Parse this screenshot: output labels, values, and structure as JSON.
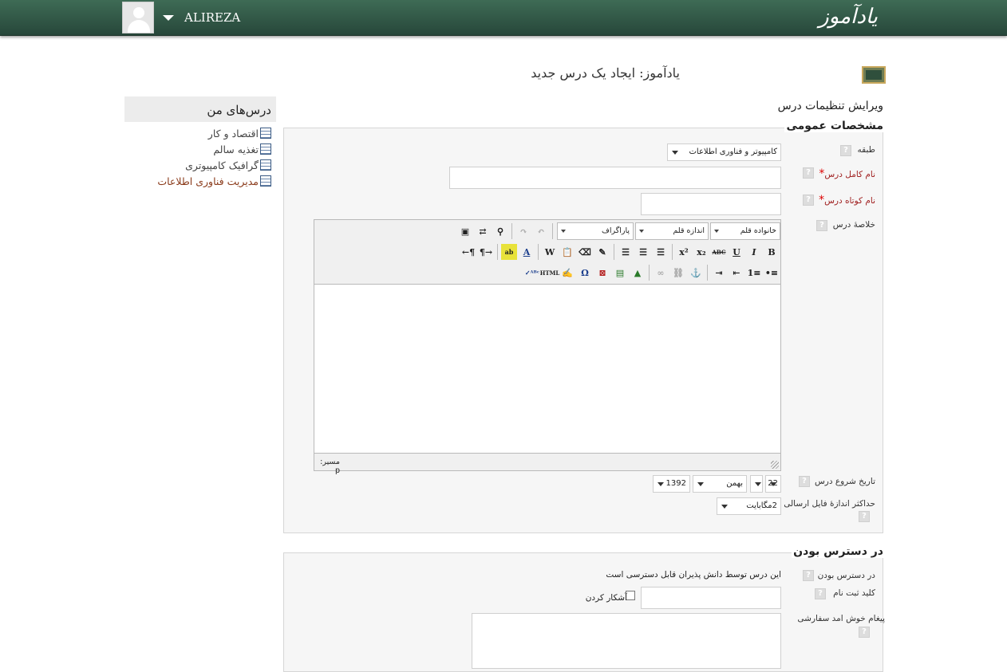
{
  "header": {
    "logo": "یادآموز",
    "username": "ALIREZA"
  },
  "page": {
    "title": "یادآموز: ایجاد یک درس جدید",
    "subtitle": "ویرایش تنظیمات درس"
  },
  "my_courses": {
    "title": "درس‌های من",
    "items": [
      "اقتصاد و کار",
      "تغذیه سالم",
      "گرافیک کامپیوتری",
      "مدیریت فناوری اطلاعات"
    ]
  },
  "general": {
    "legend": "مشخصات عمومی",
    "category_label": "طبقه",
    "category_value": "کامپیوتر و فناوری اطلاعات",
    "fullname_label": "نام کامل درس",
    "shortname_label": "نام کوتاه درس",
    "summary_label": "خلاصهٔ درس",
    "editor": {
      "font_family": "خانواده قلم",
      "font_size": "اندازه قلم",
      "paragraph": "پاراگراف",
      "path_label": "مسیر: p"
    },
    "start_date_label": "تاریخ شروع درس",
    "start_day": "22",
    "start_month": "بهمن",
    "start_year": "1392",
    "maxbytes_label": "حداکثر اندازهٔ فایل ارسالی",
    "maxbytes_value": "2مگابایت"
  },
  "availability": {
    "legend": "در دسترس بودن",
    "visible_label": "در دسترس بودن",
    "visible_value": "این درس توسط دانش پذیران قابل دسترسی است",
    "enrolkey_label": "کلید ثبت نام",
    "unmask_label": "آشکار کردن",
    "welcome_label": "پیغام خوش امد سفارشی"
  }
}
